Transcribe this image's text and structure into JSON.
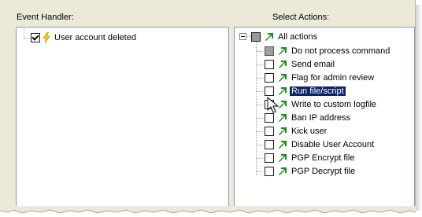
{
  "labels": {
    "event_handler": "Event Handler:",
    "select_actions": "Select Actions:"
  },
  "event_handlers": [
    {
      "label": "User account deleted",
      "checked": true,
      "icon": "lightning-bolt-icon"
    }
  ],
  "actions_root": {
    "label": "All actions",
    "state": "partial",
    "expanded": true
  },
  "actions": [
    {
      "label": "Do not process command",
      "state": "disabled"
    },
    {
      "label": "Send email",
      "state": "unchecked"
    },
    {
      "label": "Flag for admin review",
      "state": "unchecked"
    },
    {
      "label": "Run file/script",
      "state": "unchecked",
      "selected": true
    },
    {
      "label": "Write to custom logfile",
      "state": "unchecked"
    },
    {
      "label": "Ban IP address",
      "state": "unchecked"
    },
    {
      "label": "Kick user",
      "state": "unchecked"
    },
    {
      "label": "Disable User Account",
      "state": "unchecked"
    },
    {
      "label": "PGP Encrypt file",
      "state": "unchecked"
    },
    {
      "label": "PGP Decrypt file",
      "state": "unchecked"
    }
  ],
  "colors": {
    "selection": "#0a246a",
    "arrow_green": "#1a8a1a",
    "bolt_yellow": "#ffd200",
    "panel_border": "#7f9db9",
    "dialog_bg": "#ece9d8"
  }
}
